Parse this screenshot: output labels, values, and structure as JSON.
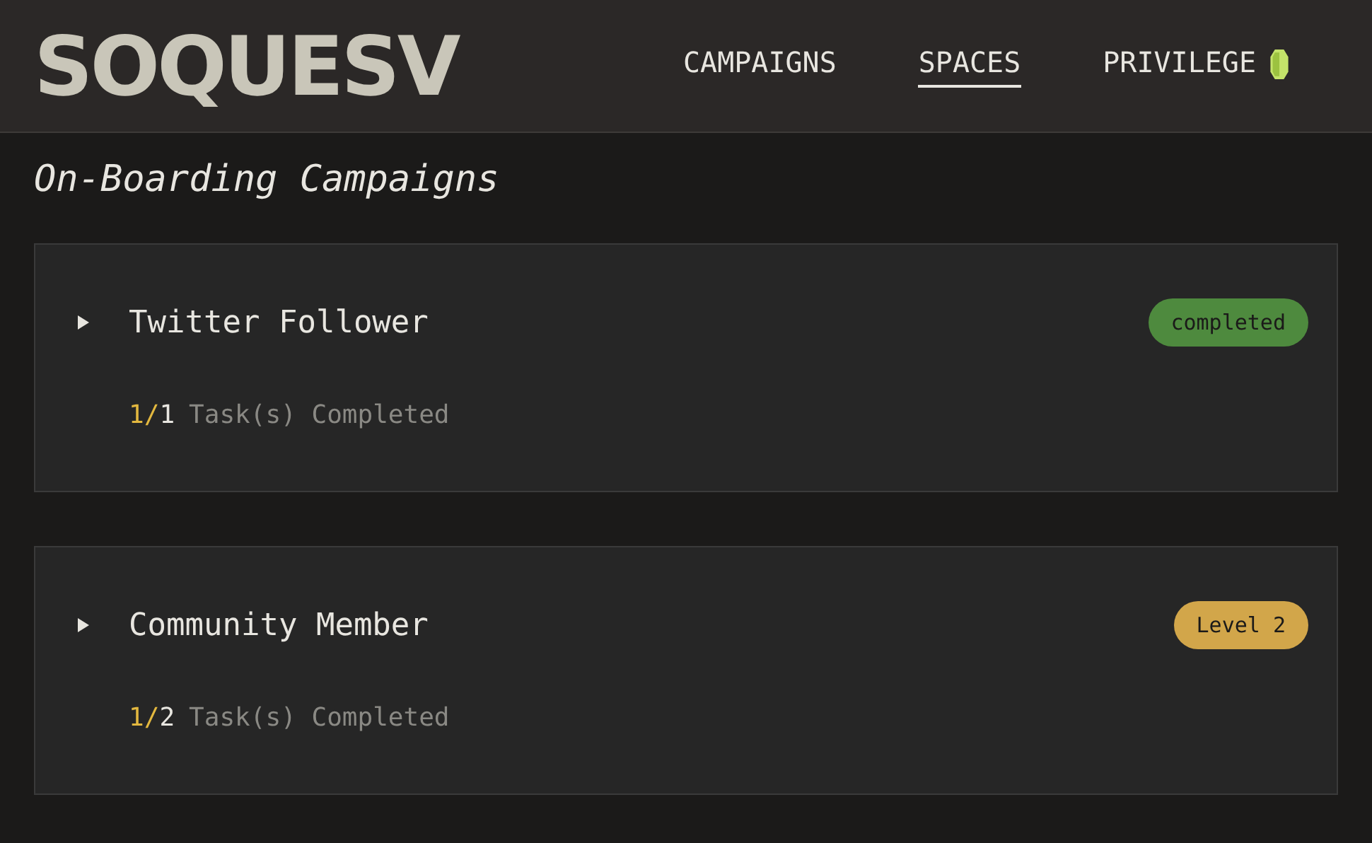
{
  "header": {
    "logo": "SOQUESV",
    "nav": [
      {
        "label": "CAMPAIGNS",
        "selected": false,
        "gem": false
      },
      {
        "label": "SPACES",
        "selected": true,
        "gem": false
      },
      {
        "label": "PRIVILEGE",
        "selected": false,
        "gem": true
      }
    ]
  },
  "title": "On-Boarding Campaigns",
  "campaigns": [
    {
      "name": "Twitter Follower",
      "expanded": false,
      "badge": "completed",
      "color": "#4e8a3e",
      "done": "1/",
      "total": "1",
      "label": "Task(s) Completed"
    },
    {
      "name": "Community Member",
      "expanded": false,
      "badge": "Level 2",
      "color": "#d2a64a",
      "done": "1/",
      "total": "2",
      "label": "Task(s) Completed"
    }
  ]
}
